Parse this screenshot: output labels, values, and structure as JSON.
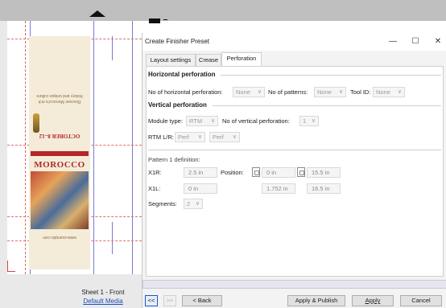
{
  "canvas": {
    "sheet_label": "Sheet 1 - Front",
    "media_link": "Default Media",
    "card_title": "MOROCCO",
    "card_subtitle": "OCTOBER 8–12",
    "card_upside_text": "Discover Morocco's rich history and unique culture",
    "card_small_text": "www.example.com"
  },
  "dialog": {
    "title": "Create Finisher Preset",
    "tabs": [
      {
        "label": "Layout settings"
      },
      {
        "label": "Crease"
      },
      {
        "label": "Perforation"
      }
    ],
    "horizontal": {
      "heading": "Horizontal perforation",
      "count_label": "No of horizontal perforation:",
      "count_value": "None",
      "patterns_label": "No of patterns:",
      "patterns_value": "None",
      "tool_label": "Tool ID:",
      "tool_value": "None"
    },
    "vertical": {
      "heading": "Vertical perforation",
      "module_label": "Module type:",
      "module_value": "RTM",
      "count_label": "No of vertical perforation:",
      "count_value": "1",
      "rtm_label": "RTM L/R:",
      "rtm_left": "Perf",
      "rtm_right": "Perf"
    },
    "pattern": {
      "heading": "Pattern 1 definition:",
      "x1r_label": "X1R:",
      "x1r_value": "2.5 in",
      "position_label": "Position:",
      "pos_a": "0 in",
      "pos_b": "15.5 in",
      "x1l_label": "X1L:",
      "x1l_value": "0 in",
      "pos_c": "1.752 in",
      "pos_d": "16.5 in",
      "segments_label": "Segments:",
      "segments_value": "2"
    },
    "buttons": {
      "first": "<<",
      "next": ">>",
      "back": "< Back",
      "apply_publish": "Apply & Publish",
      "apply": "Apply",
      "cancel": "Cancel"
    },
    "window_controls": {
      "minimize": "—",
      "maximize": "☐",
      "close": "✕"
    }
  },
  "colors": {
    "accent": "#1a57c7",
    "brand_red": "#b3262b",
    "guide_blue": "#7a7ad6",
    "guide_red": "#e06060"
  }
}
